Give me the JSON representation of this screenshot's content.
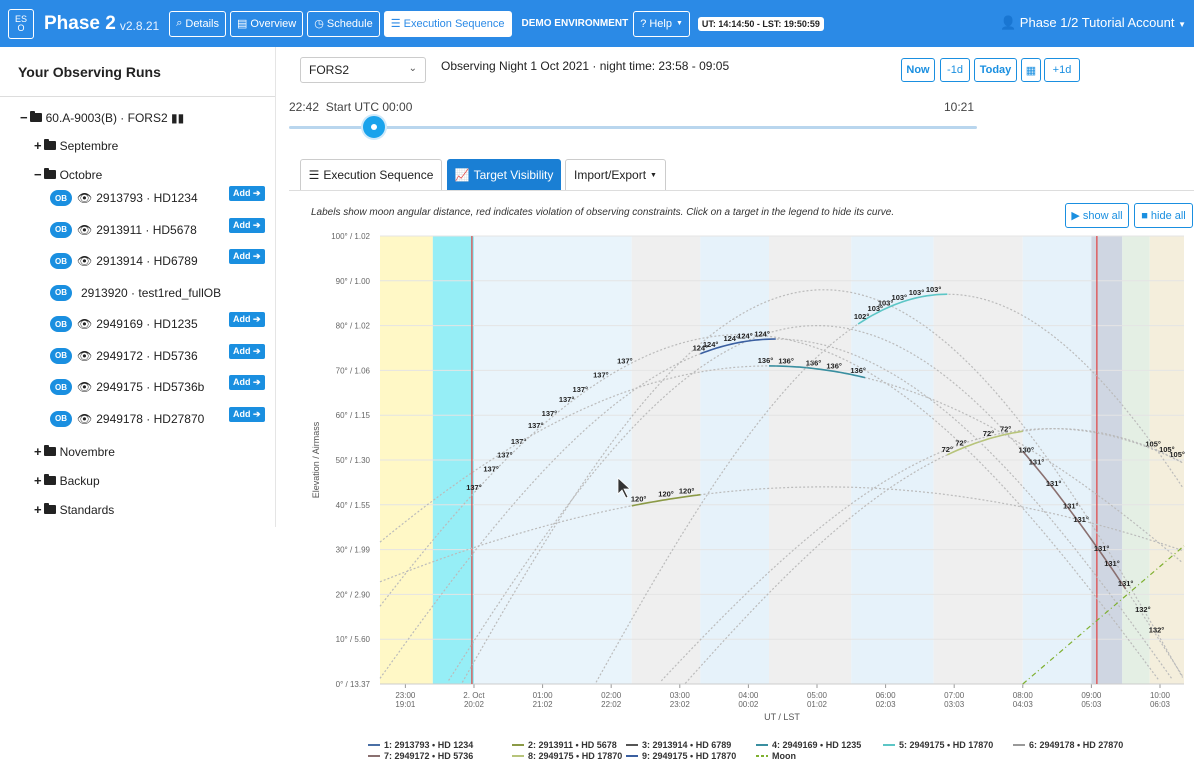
{
  "navbar": {
    "logo_text": "ES\nO",
    "title": "Phase 2",
    "version": "v2.8.21",
    "buttons": [
      {
        "icon": "search-icon",
        "label": "Details"
      },
      {
        "icon": "list-icon",
        "label": "Overview"
      },
      {
        "icon": "clock-icon",
        "label": "Schedule"
      },
      {
        "icon": "list-ordered-icon",
        "label": "Execution Sequence"
      }
    ],
    "demo_label": "DEMO ENVIRONMENT",
    "help_label": "Help",
    "time_pill": "UT: 14:14:50 - LST: 19:50:59",
    "account": "Phase 1/2 Tutorial Account",
    "accent": "#2b8ae6"
  },
  "sidebar": {
    "title": "Your Observing Runs",
    "run": "60.A-9003(B) · FORS2",
    "folders": {
      "septembre": "Septembre",
      "octobre": "Octobre",
      "novembre": "Novembre",
      "backup": "Backup",
      "standards": "Standards"
    },
    "ob_badge": "OB",
    "add_label": "Add",
    "obs": [
      {
        "label": "2913793 · HD1234",
        "eye": true,
        "add": true
      },
      {
        "label": "2913911 · HD5678",
        "eye": true,
        "add": true
      },
      {
        "label": "2913914 · HD6789",
        "eye": true,
        "add": true
      },
      {
        "label": "2913920 · test1red_fullOB",
        "eye": false,
        "add": false
      },
      {
        "label": "2949169 · HD1235",
        "eye": true,
        "add": true
      },
      {
        "label": "2949172 · HD5736",
        "eye": true,
        "add": true
      },
      {
        "label": "2949175 · HD5736b",
        "eye": true,
        "add": true
      },
      {
        "label": "2949178 · HD27870",
        "eye": true,
        "add": true
      }
    ]
  },
  "toolbar": {
    "instrument": "FORS2",
    "night_info": "Observing Night 1 Oct 2021 · night time: 23:58 - 09:05",
    "now": "Now",
    "minus": "-1d",
    "today": "Today",
    "plus": "+1d",
    "range_start": "22:42",
    "range_label": "Start UTC 00:00",
    "range_end": "10:21"
  },
  "tabs": {
    "exec": "Execution Sequence",
    "vis": "Target Visibility",
    "imp": "Import/Export"
  },
  "hint": "Labels show moon angular distance, red indicates violation of observing constraints. Click on a target in the legend to hide its curve.",
  "show_all": "show all",
  "hide_all": "hide all",
  "chart_data": {
    "type": "line",
    "ylabel": "Elevation / Airmass",
    "xlabel": "UT / LST",
    "ylim": [
      0,
      100
    ],
    "y_ticks": [
      "0° / 13.37",
      "10° / 5.60",
      "20° / 2.90",
      "30° / 1.99",
      "40° / 1.55",
      "50° / 1.30",
      "60° / 1.15",
      "70° / 1.06",
      "80° / 1.02",
      "90° / 1.00",
      "100° / 1.02"
    ],
    "x_ticks": [
      {
        "ut": "23:00",
        "lst": "19:01"
      },
      {
        "ut": "2. Oct",
        "lst": "20:02"
      },
      {
        "ut": "01:00",
        "lst": "21:02"
      },
      {
        "ut": "02:00",
        "lst": "22:02"
      },
      {
        "ut": "03:00",
        "lst": "23:02"
      },
      {
        "ut": "04:00",
        "lst": "00:02"
      },
      {
        "ut": "05:00",
        "lst": "01:02"
      },
      {
        "ut": "06:00",
        "lst": "02:03"
      },
      {
        "ut": "07:00",
        "lst": "03:03"
      },
      {
        "ut": "08:00",
        "lst": "04:03"
      },
      {
        "ut": "09:00",
        "lst": "05:03"
      },
      {
        "ut": "10:00",
        "lst": "06:03"
      }
    ],
    "xlim_hours": [
      22.63,
      10.35
    ],
    "night_bounds": [
      23.97,
      9.08
    ],
    "series": [
      {
        "name": "1: 2913793 • HD 1234",
        "color": "#4a6fa5",
        "peak_h": 3.9,
        "peak_el": 78,
        "width": 4.2,
        "active": [
          23.97,
          2.3
        ],
        "labels": [
          {
            "h": 0.0,
            "t": "137°"
          },
          {
            "h": 0.25,
            "t": "137°"
          },
          {
            "h": 0.45,
            "t": "137°"
          },
          {
            "h": 0.65,
            "t": "137°"
          },
          {
            "h": 0.9,
            "t": "137°"
          },
          {
            "h": 1.1,
            "t": "137°"
          },
          {
            "h": 1.35,
            "t": "137°"
          },
          {
            "h": 1.55,
            "t": "137°"
          },
          {
            "h": 1.85,
            "t": "137°"
          },
          {
            "h": 2.2,
            "t": "137°"
          }
        ]
      },
      {
        "name": "2: 2913911 • HD 5678",
        "color": "#8b9a46",
        "peak_h": 5.1,
        "peak_el": 44,
        "width": 7,
        "active": [
          2.3,
          3.3
        ],
        "labels": [
          {
            "h": 2.4,
            "t": "120°"
          },
          {
            "h": 2.8,
            "t": "120°"
          },
          {
            "h": 3.1,
            "t": "120°"
          }
        ]
      },
      {
        "name": "3: 2913914 • HD 6789",
        "color": "#555555",
        "peak_h": 5.1,
        "peak_el": 88,
        "width": 3.6,
        "active": null,
        "labels": []
      },
      {
        "name": "4: 2949169 • HD 1235",
        "color": "#3a8fa0",
        "peak_h": 4.3,
        "peak_el": 71,
        "width": 5.5,
        "active": [
          4.3,
          5.7
        ],
        "labels": [
          {
            "h": 4.25,
            "t": "136°"
          },
          {
            "h": 4.55,
            "t": "136°"
          },
          {
            "h": 4.95,
            "t": "136°"
          },
          {
            "h": 5.25,
            "t": "136°"
          },
          {
            "h": 5.6,
            "t": "136°"
          }
        ]
      },
      {
        "name": "5: 2949175 • HD 17870",
        "color": "#5cc6c6",
        "peak_h": 6.9,
        "peak_el": 87,
        "width": 3.5,
        "active": [
          5.6,
          6.9
        ],
        "labels": [
          {
            "h": 5.65,
            "t": "102°"
          },
          {
            "h": 5.85,
            "t": "103°"
          },
          {
            "h": 6.0,
            "t": "103°"
          },
          {
            "h": 6.2,
            "t": "103°"
          },
          {
            "h": 6.45,
            "t": "103°"
          },
          {
            "h": 6.7,
            "t": "103°"
          }
        ]
      },
      {
        "name": "6: 2949178 • HD 27870",
        "color": "#999999",
        "peak_h": 8.4,
        "peak_el": 57,
        "width": 4.0,
        "active": null,
        "labels": [
          {
            "h": 9.9,
            "t": "105°"
          },
          {
            "h": 10.1,
            "t": "105°"
          },
          {
            "h": 10.25,
            "t": "105°"
          }
        ]
      },
      {
        "name": "7: 2949172 • HD 5736",
        "color": "#8a7070",
        "peak_h": 5.0,
        "peak_el": 80,
        "width": 3.7,
        "active": [
          8.0,
          9.5
        ],
        "labels": [
          {
            "h": 8.05,
            "t": "130°"
          },
          {
            "h": 8.2,
            "t": "131°"
          },
          {
            "h": 8.45,
            "t": "131°"
          },
          {
            "h": 8.7,
            "t": "131°"
          },
          {
            "h": 8.85,
            "t": "131°"
          },
          {
            "h": 9.15,
            "t": "131°"
          },
          {
            "h": 9.3,
            "t": "131°"
          },
          {
            "h": 9.5,
            "t": "131°"
          },
          {
            "h": 9.75,
            "t": "132°"
          },
          {
            "h": 9.95,
            "t": "132°"
          }
        ]
      },
      {
        "name": "8: 2949175 • HD 17870",
        "color": "#b7c47a",
        "peak_h": 8.5,
        "peak_el": 57,
        "width": 3.8,
        "active": [
          6.9,
          8.0
        ],
        "labels": [
          {
            "h": 6.9,
            "t": "72°"
          },
          {
            "h": 7.1,
            "t": "72°"
          },
          {
            "h": 7.5,
            "t": "72°"
          },
          {
            "h": 7.75,
            "t": "72°"
          }
        ]
      },
      {
        "name": "9: 2949175 • HD 17870",
        "color": "#3a5fa0",
        "peak_h": 4.4,
        "peak_el": 77,
        "width": 4.0,
        "active": [
          3.3,
          4.4
        ],
        "labels": [
          {
            "h": 3.3,
            "t": "124°"
          },
          {
            "h": 3.45,
            "t": "124°"
          },
          {
            "h": 3.75,
            "t": "124°"
          },
          {
            "h": 3.95,
            "t": "124°"
          },
          {
            "h": 4.2,
            "t": "124°"
          }
        ]
      },
      {
        "name": "Moon",
        "color": "#7fb030",
        "dash": true,
        "rise_h": 8.0,
        "rate": 20.5,
        "labels": []
      }
    ]
  }
}
